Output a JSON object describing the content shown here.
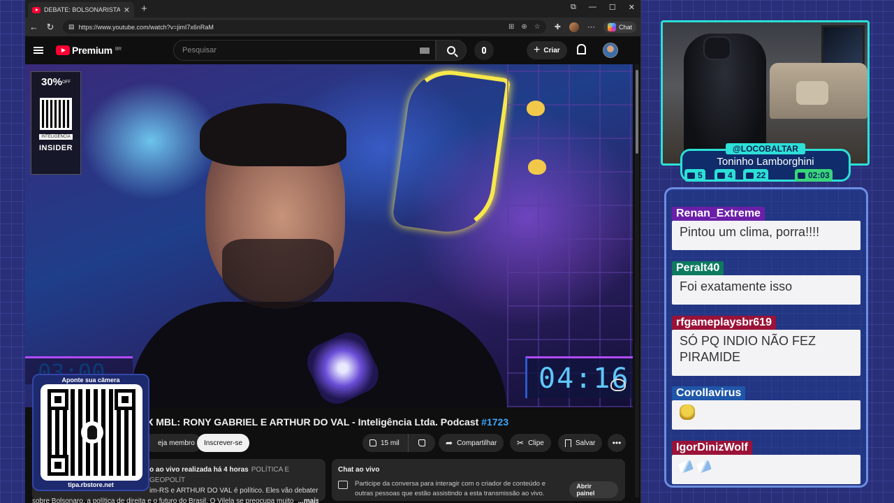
{
  "browser": {
    "tab_title": "DEBATE: BOLSONARISTA X MBL: R",
    "url": "https://www.youtube.com/watch?v=jimI7x6nRaM",
    "chat_label": "Chat"
  },
  "youtube": {
    "logo_text": "Premium",
    "logo_region": "BR",
    "search_placeholder": "Pesquisar",
    "create_label": "Criar"
  },
  "video": {
    "ad_percent": "30%",
    "ad_percent_suffix": "OFF",
    "ad_tag": "INTELIGÊNCIA",
    "ad_brand": "INSIDER",
    "timer_left": "03:00",
    "timer_right": "04:16",
    "title_visible": "X MBL: RONY GABRIEL E ARTHUR DO VAL - Inteligência Ltda. Podcast ",
    "episode": "#1723"
  },
  "actions": {
    "member_label": "eja membro",
    "subscribe_label": "Inscrever-se",
    "likes": "15 mil",
    "share_label": "Compartilhar",
    "clip_label": "Clipe",
    "save_label": "Salvar"
  },
  "description": {
    "meta": "o ao vivo realizada há 4 horas",
    "tags": "POLÍTICA E GEOPOLÍT",
    "line2": "im-RS e ARTHUR DO VAL é político. Eles vão debater",
    "line3": "sobre Bolsonaro, a política de direita e o futuro do Brasil. O Vilela se preocupa muito",
    "more": "...mais"
  },
  "live_chat": {
    "title": "Chat ao vivo",
    "text": "Participe da conversa para interagir com o criador de conteúdo e outras pessoas que estão assistindo a esta transmissão ao vivo.",
    "open_panel": "Abrir painel"
  },
  "qr_overlay": {
    "top_text": "Aponte sua câmera",
    "bottom_text": "tipa.rbstore.net"
  },
  "streamer": {
    "handle": "@LOCOBALTAR",
    "name": "Toninho Lamborghini",
    "stats": [
      "5",
      "4",
      "22",
      "02:03"
    ]
  },
  "chat": [
    {
      "user": "Renan_Extreme",
      "text": "Pintou um clima, porra!!!!",
      "color": "#6b1fa8"
    },
    {
      "user": "Peralt40",
      "text": "Foi exatamente isso",
      "color": "#0e7a60"
    },
    {
      "user": "rfgameplaysbr619",
      "text": "SÓ PQ INDIO NÃO FEZ PIRAMIDE",
      "color": "#9a1238"
    },
    {
      "user": "Corollavirus",
      "text": "",
      "color": "#1f56a8"
    },
    {
      "user": "IgorDinizWolf",
      "text": "",
      "color": "#9a1238"
    }
  ]
}
